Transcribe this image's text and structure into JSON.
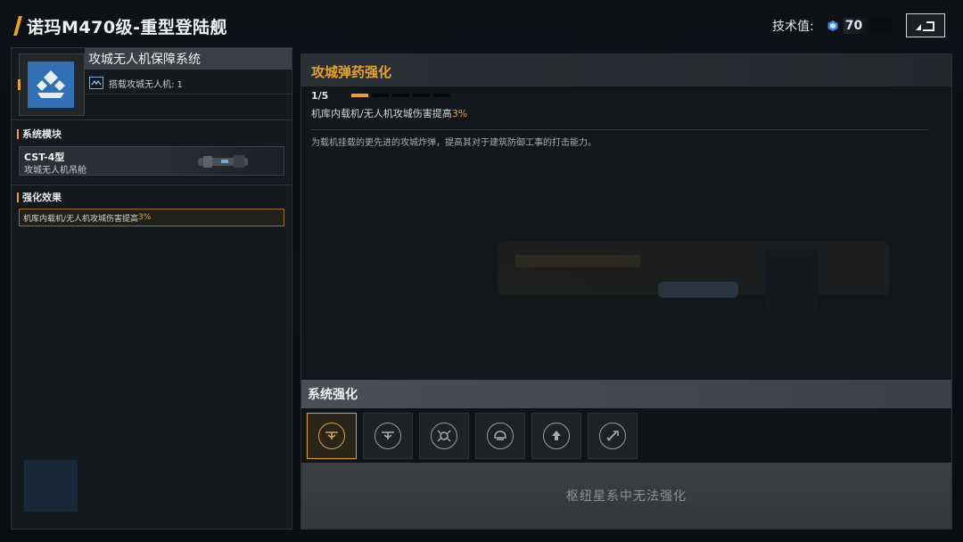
{
  "header": {
    "title": "诺玛M470级-重型登陆舰",
    "tech_label": "技术值:",
    "tech_value": "70"
  },
  "left_panel": {
    "system_name": "攻城无人机保障系统",
    "carry_text": "搭载攻城无人机: 1",
    "module_section_label": "系统模块",
    "module_name": "CST-4型",
    "module_desc": "攻城无人机吊舱",
    "effect_section_label": "强化效果",
    "effect_prefix": "机库内载机/无人机攻城伤害提高",
    "effect_value": "3%"
  },
  "upgrade": {
    "title": "攻城弹药强化",
    "progress_text": "1/5",
    "level": 1,
    "max_level": 5,
    "effect_prefix": "机库内载机/无人机攻城伤害提高",
    "effect_value": "3%",
    "description": "为载机挂载的更先进的攻城炸弹，提高其对于建筑防御工事的打击能力。"
  },
  "enhancement": {
    "section_label": "系统强化",
    "slots": [
      {
        "icon": "drone-icon",
        "selected": true
      },
      {
        "icon": "drone-icon",
        "selected": false
      },
      {
        "icon": "radar-drone-icon",
        "selected": false
      },
      {
        "icon": "helmet-drone-icon",
        "selected": false
      },
      {
        "icon": "arrow-up-icon",
        "selected": false
      },
      {
        "icon": "missile-icon",
        "selected": false
      }
    ],
    "locked_text": "枢纽星系中无法强化"
  },
  "colors": {
    "accent": "#e8a12b",
    "icon_blue": "#2f6fb2"
  }
}
